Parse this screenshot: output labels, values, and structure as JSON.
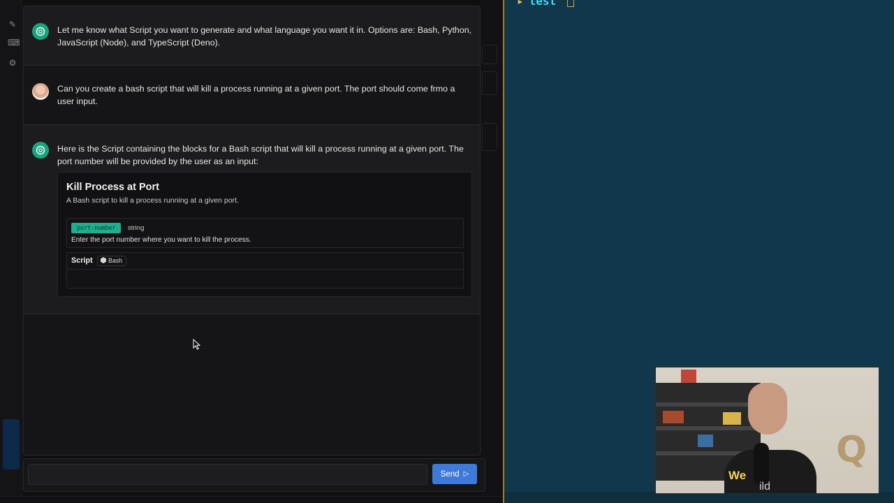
{
  "messages": [
    {
      "role": "assistant",
      "text": "Let me know what Script you want to generate and what language you want it in. Options are: Bash, Python, JavaScript (Node), and TypeScript (Deno)."
    },
    {
      "role": "user",
      "text": "Can you create a bash script that will kill a process running at a given port. The port should come frmo a user input."
    },
    {
      "role": "assistant",
      "text": "Here is the Script containing the blocks for a Bash script that will kill a process running at a given port. The port number will be provided by the user as an input:"
    }
  ],
  "script_card": {
    "title": "Kill Process at Port",
    "description": "A Bash script to kill a process running at a given port.",
    "argument": {
      "name": "port-number",
      "type": "string",
      "description": "Enter the port number where you want to kill the process."
    },
    "script_label": "Script",
    "language": "Bash"
  },
  "composer": {
    "input_value": "",
    "input_placeholder": "",
    "send_label": "Send"
  },
  "editor": {
    "code_text": "test"
  },
  "webcam": {
    "shirt_line1": "We",
    "shirt_line2": "ild"
  },
  "colors": {
    "accent_green": "#19a37f",
    "badge_teal": "#1fae8f",
    "send_blue": "#3f7ad9",
    "editor_bg": "#11374a",
    "divider_gold": "#a67c1a"
  },
  "icons": [
    "openai-icon",
    "user-avatar",
    "bash-icon",
    "send-icon",
    "edit-icon",
    "terminal-icon",
    "gear-icon"
  ]
}
